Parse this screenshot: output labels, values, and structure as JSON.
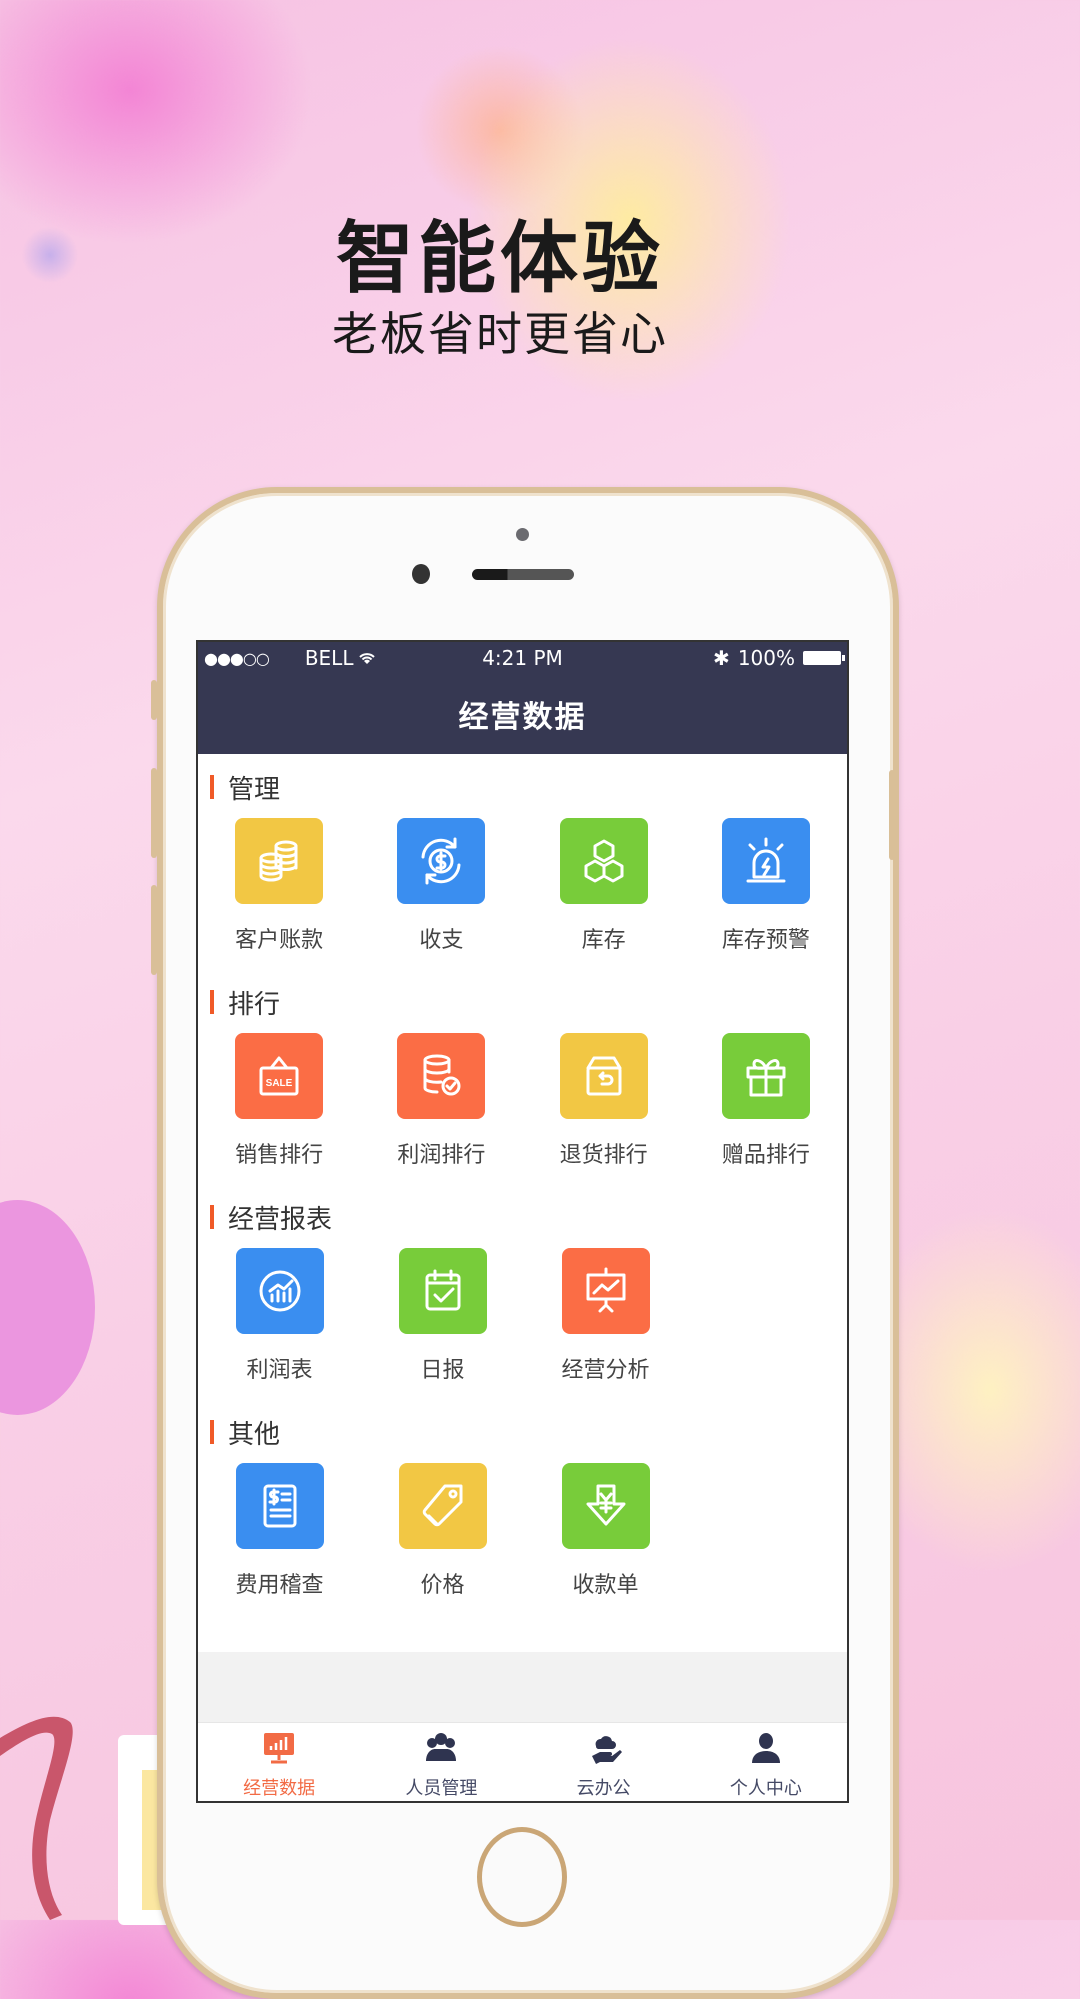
{
  "promo": {
    "title": "智能体验",
    "subtitle": "老板省时更省心"
  },
  "status_bar": {
    "signal": "●●●○○",
    "carrier": "BELL",
    "time": "4:21 PM",
    "bluetooth": "✱",
    "battery": "100%"
  },
  "nav": {
    "title": "经营数据"
  },
  "colors": {
    "yellow": "#f2c744",
    "blue": "#3a8ef0",
    "green": "#78cc3a",
    "orange": "#fb6d45",
    "accent": "#f05a28",
    "navbar": "#363852"
  },
  "sections": [
    {
      "title": "管理",
      "items": [
        {
          "label": "客户账款",
          "icon": "coins-icon",
          "color": "yellow"
        },
        {
          "label": "收支",
          "icon": "dollar-exchange-icon",
          "color": "blue"
        },
        {
          "label": "库存",
          "icon": "boxes-icon",
          "color": "green"
        },
        {
          "label": "库存预警",
          "icon": "alarm-light-icon",
          "color": "blue"
        }
      ]
    },
    {
      "title": "排行",
      "items": [
        {
          "label": "销售排行",
          "icon": "sale-sign-icon",
          "color": "orange"
        },
        {
          "label": "利润排行",
          "icon": "database-check-icon",
          "color": "orange"
        },
        {
          "label": "退货排行",
          "icon": "return-box-icon",
          "color": "yellow"
        },
        {
          "label": "赠品排行",
          "icon": "gift-icon",
          "color": "green"
        }
      ]
    },
    {
      "title": "经营报表",
      "items": [
        {
          "label": "利润表",
          "icon": "chart-circle-icon",
          "color": "blue"
        },
        {
          "label": "日报",
          "icon": "calendar-check-icon",
          "color": "green"
        },
        {
          "label": "经营分析",
          "icon": "presentation-icon",
          "color": "orange"
        }
      ]
    },
    {
      "title": "其他",
      "items": [
        {
          "label": "费用稽查",
          "icon": "invoice-icon",
          "color": "blue"
        },
        {
          "label": "价格",
          "icon": "price-tag-icon",
          "color": "yellow"
        },
        {
          "label": "收款单",
          "icon": "yuan-download-icon",
          "color": "green"
        }
      ]
    }
  ],
  "tabs": [
    {
      "label": "经营数据",
      "icon": "monitor-chart-icon",
      "active": true
    },
    {
      "label": "人员管理",
      "icon": "people-icon",
      "active": false
    },
    {
      "label": "云办公",
      "icon": "cloud-hand-icon",
      "active": false
    },
    {
      "label": "个人中心",
      "icon": "user-icon",
      "active": false
    }
  ]
}
